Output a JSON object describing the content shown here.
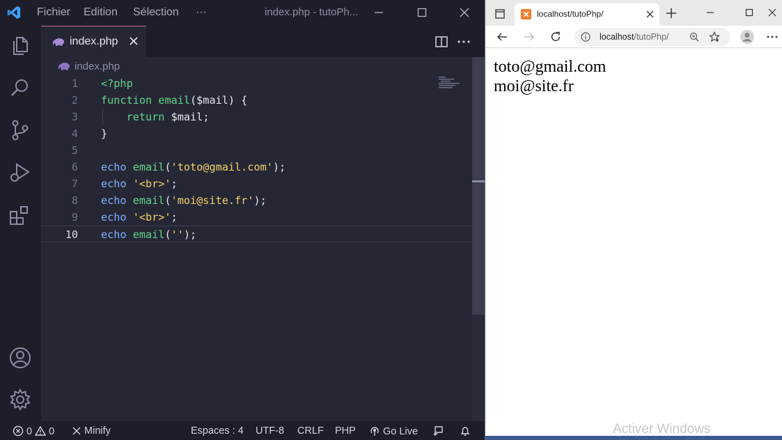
{
  "vscode": {
    "menu": [
      "Fichier",
      "Edition",
      "Sélection",
      "···"
    ],
    "window_title": "index.php - tutoPh...",
    "tab": {
      "label": "index.php"
    },
    "breadcrumb": "index.php",
    "code_lines": [
      {
        "n": "1",
        "tokens": [
          {
            "t": "<?php",
            "c": "fn"
          }
        ]
      },
      {
        "n": "2",
        "tokens": [
          {
            "t": "function ",
            "c": "fn"
          },
          {
            "t": "email",
            "c": "fn"
          },
          {
            "t": "($mail) {",
            "c": "var"
          }
        ]
      },
      {
        "n": "3",
        "tokens": [
          {
            "t": "    ",
            "c": "var"
          },
          {
            "t": "return",
            "c": "fn"
          },
          {
            "t": " $mail;",
            "c": "var"
          }
        ]
      },
      {
        "n": "4",
        "tokens": [
          {
            "t": "}",
            "c": "var"
          }
        ]
      },
      {
        "n": "5",
        "tokens": []
      },
      {
        "n": "6",
        "tokens": [
          {
            "t": "echo ",
            "c": "kw"
          },
          {
            "t": "email",
            "c": "fn"
          },
          {
            "t": "(",
            "c": "var"
          },
          {
            "t": "'toto@gmail.com'",
            "c": "str"
          },
          {
            "t": ");",
            "c": "var"
          }
        ]
      },
      {
        "n": "7",
        "tokens": [
          {
            "t": "echo ",
            "c": "kw"
          },
          {
            "t": "'<br>'",
            "c": "str"
          },
          {
            "t": ";",
            "c": "var"
          }
        ]
      },
      {
        "n": "8",
        "tokens": [
          {
            "t": "echo ",
            "c": "kw"
          },
          {
            "t": "email",
            "c": "fn"
          },
          {
            "t": "(",
            "c": "var"
          },
          {
            "t": "'moi@site.fr'",
            "c": "str"
          },
          {
            "t": ");",
            "c": "var"
          }
        ]
      },
      {
        "n": "9",
        "tokens": [
          {
            "t": "echo ",
            "c": "kw"
          },
          {
            "t": "'<br>'",
            "c": "str"
          },
          {
            "t": ";",
            "c": "var"
          }
        ]
      },
      {
        "n": "10",
        "tokens": [
          {
            "t": "echo ",
            "c": "kw"
          },
          {
            "t": "email",
            "c": "fn"
          },
          {
            "t": "(",
            "c": "var"
          },
          {
            "t": "''",
            "c": "str"
          },
          {
            "t": ");",
            "c": "var"
          }
        ]
      }
    ],
    "current_line": "10",
    "status": {
      "errors": "0",
      "warnings": "0",
      "minify": "Minify",
      "spaces": "Espaces : 4",
      "encoding": "UTF-8",
      "eol": "CRLF",
      "language": "PHP",
      "golive": "Go Live"
    },
    "colors": {
      "accent": "#cc6aa3",
      "keyword": "#7fb0ff",
      "function": "#5fd68a",
      "string": "#f2d16b"
    }
  },
  "browser": {
    "tab_title": "localhost/tutoPhp/",
    "url_host": "localhost",
    "url_path": "/tutoPhp/",
    "output_lines": [
      "toto@gmail.com",
      "moi@site.fr"
    ],
    "watermark": "Activer Windows"
  }
}
